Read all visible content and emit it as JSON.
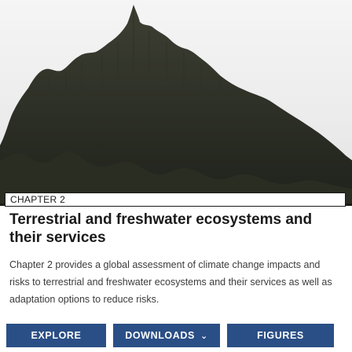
{
  "hero": {
    "image": "forest-canopy-silhouette"
  },
  "chapter": {
    "kicker": "CHAPTER 2",
    "title": "Terrestrial and freshwater ecosystems and their services",
    "description": "Chapter 2 provides a global assessment of climate change impacts and risks to terrestrial and freshwater ecosystems and their services as well as adaptation options to reduce risks."
  },
  "actions": {
    "explore": "EXPLORE",
    "downloads": "DOWNLOADS",
    "downloads_icon": "chevron-down-icon",
    "figures": "FIGURES"
  },
  "colors": {
    "button": "#2a4f86",
    "text": "#1a1a1a"
  }
}
